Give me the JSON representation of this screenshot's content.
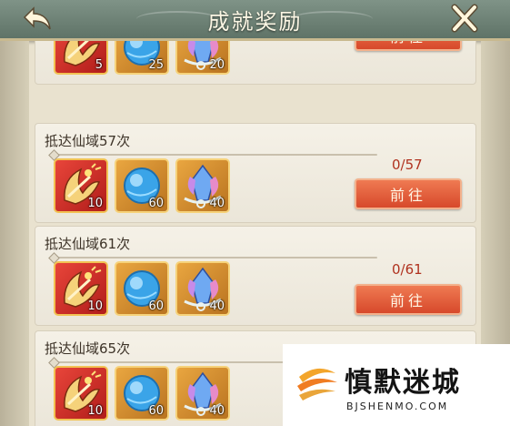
{
  "header": {
    "title": "成就奖励",
    "back_icon": "back-arrow-icon",
    "close_icon": "close-icon"
  },
  "achievements": [
    {
      "name": "",
      "progress": "",
      "button": "前往",
      "rewards": [
        {
          "icon": "fan-treasure-icon",
          "qty": "5"
        },
        {
          "icon": "blue-orb-icon",
          "qty": "25"
        },
        {
          "icon": "crystal-gem-icon",
          "qty": "20"
        }
      ]
    },
    {
      "name": "抵达仙域57次",
      "progress": "0/57",
      "progress_value": 0,
      "button": "前往",
      "rewards": [
        {
          "icon": "fan-treasure-icon",
          "qty": "10"
        },
        {
          "icon": "blue-orb-icon",
          "qty": "60"
        },
        {
          "icon": "crystal-gem-icon",
          "qty": "40"
        }
      ]
    },
    {
      "name": "抵达仙域61次",
      "progress": "0/61",
      "progress_value": 0,
      "button": "前往",
      "rewards": [
        {
          "icon": "fan-treasure-icon",
          "qty": "10"
        },
        {
          "icon": "blue-orb-icon",
          "qty": "60"
        },
        {
          "icon": "crystal-gem-icon",
          "qty": "40"
        }
      ]
    },
    {
      "name": "抵达仙域65次",
      "progress": "",
      "progress_value": 0,
      "button": "",
      "rewards": [
        {
          "icon": "fan-treasure-icon",
          "qty": "10"
        },
        {
          "icon": "blue-orb-icon",
          "qty": "60"
        },
        {
          "icon": "crystal-gem-icon",
          "qty": "40"
        }
      ]
    }
  ],
  "watermark": {
    "text": "慎默迷城",
    "sub": "BJSHENMO.COM"
  },
  "colors": {
    "button": "#d7492b",
    "progress_text": "#b0321f",
    "header": "#6d8276"
  }
}
